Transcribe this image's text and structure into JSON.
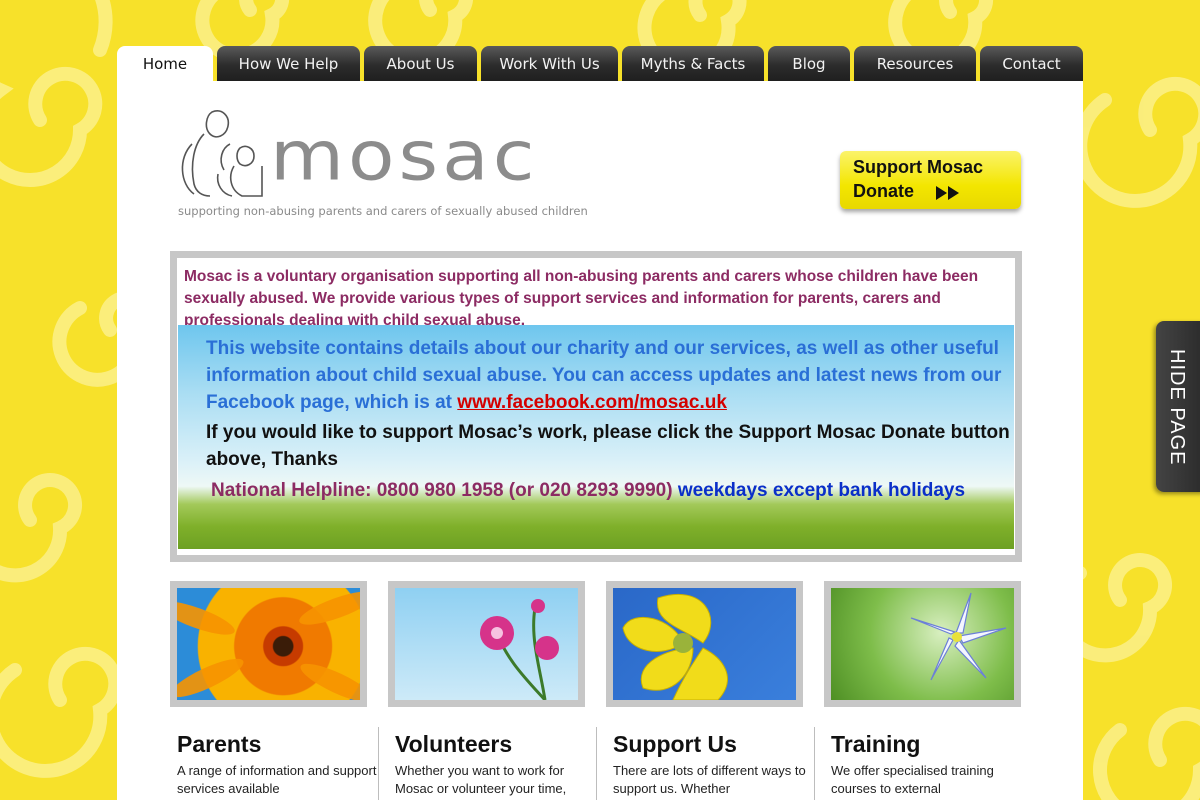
{
  "nav": {
    "tabs": [
      {
        "label": "Home",
        "active": true
      },
      {
        "label": "How We Help"
      },
      {
        "label": "About Us"
      },
      {
        "label": "Work With Us"
      },
      {
        "label": "Myths & Facts"
      },
      {
        "label": "Blog"
      },
      {
        "label": "Resources"
      },
      {
        "label": "Contact"
      }
    ]
  },
  "logo": {
    "word": "mosac",
    "tagline": "supporting non-abusing parents and carers of sexually abused children"
  },
  "donate": {
    "line1": "Support Mosac",
    "line2": "Donate"
  },
  "intro": {
    "lead": "Mosac is a voluntary organisation supporting all non-abusing parents and carers whose children have been sexually abused. We provide various types of support services and information for parents, carers and professionals dealing with child sexual abuse.",
    "website_text": "This website contains details about our charity and our services, as well as other useful information about child sexual abuse.  You can access updates and latest news from our Facebook page, which is at ",
    "facebook_link": "www.facebook.com/mosac.uk",
    "support_text": "If you would like to support Mosac’s work, please click the Support Mosac Donate button above, Thanks",
    "helpline_label": "National Helpline: 0800 980 1958 (or 020 8293 9990)",
    "helpline_hours": " weekdays except bank holidays"
  },
  "columns": [
    {
      "title": "Parents",
      "text": "A range of information and support services available"
    },
    {
      "title": "Volunteers",
      "text": "Whether you want to work for Mosac or volunteer your time,"
    },
    {
      "title": "Support Us",
      "text": "There are lots of different ways to support us. Whether"
    },
    {
      "title": "Training",
      "text": "We offer specialised training courses to external"
    }
  ],
  "side": {
    "hide_page": "HIDE PAGE"
  },
  "colors": {
    "background": "#f7e12a",
    "accent_purple": "#8c2b63",
    "link_red": "#d40000",
    "text_blue": "#2a6fd6"
  }
}
